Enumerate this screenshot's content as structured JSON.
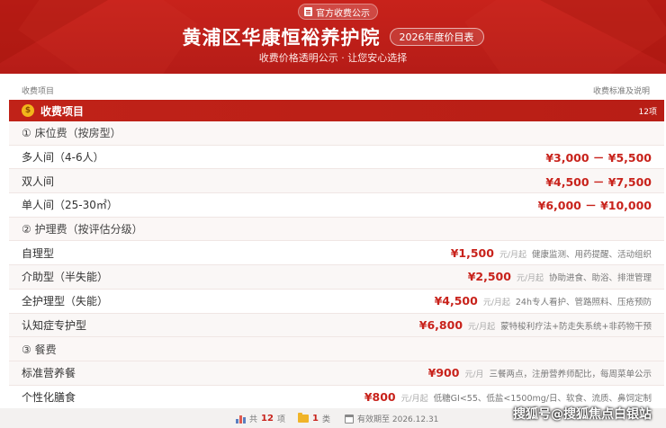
{
  "header": {
    "badge_label": "官方收费公示",
    "title": "黄浦区华康恒裕养护院",
    "year_badge": "2026年度价目表",
    "subtitle": "收费价格透明公示 · 让您安心选择"
  },
  "columns": {
    "left": "收费项目",
    "right": "收费标准及说明"
  },
  "section": {
    "icon": "money-bag-icon",
    "title": "收费项目",
    "count": "12项"
  },
  "rows": [
    {
      "type": "group",
      "name": "① 床位费（按房型）"
    },
    {
      "type": "item",
      "name": "多人间（4-6人）",
      "price": "¥3,000 － ¥5,500",
      "unit": "",
      "note": ""
    },
    {
      "type": "item",
      "name": "双人间",
      "price": "¥4,500 － ¥7,500",
      "unit": "",
      "note": ""
    },
    {
      "type": "item",
      "name": "单人间（25-30㎡）",
      "price": "¥6,000 － ¥10,000",
      "unit": "",
      "note": ""
    },
    {
      "type": "group",
      "name": "② 护理费（按评估分级）"
    },
    {
      "type": "item",
      "name": "自理型",
      "price": "¥1,500",
      "unit": "元/月起",
      "note": "健康监测、用药提醒、活动组织"
    },
    {
      "type": "item",
      "name": "介助型（半失能）",
      "price": "¥2,500",
      "unit": "元/月起",
      "note": "协助进食、助浴、排泄管理"
    },
    {
      "type": "item",
      "name": "全护理型（失能）",
      "price": "¥4,500",
      "unit": "元/月起",
      "note": "24h专人看护、管路照料、压疮预防"
    },
    {
      "type": "item",
      "name": "认知症专护型",
      "price": "¥6,800",
      "unit": "元/月起",
      "note": "蒙特梭利疗法+防走失系统+非药物干预"
    },
    {
      "type": "group",
      "name": "③ 餐费"
    },
    {
      "type": "item",
      "name": "标准营养餐",
      "price": "¥900",
      "unit": "元/月",
      "note": "三餐两点，注册营养师配比，每周菜单公示"
    },
    {
      "type": "item",
      "name": "个性化膳食",
      "price": "¥800",
      "unit": "元/月起",
      "note": "低糖GI<55、低盐<1500mg/日、软食、流质、鼻饲定制"
    }
  ],
  "footer": {
    "total_prefix": "共",
    "total_count": "12",
    "total_suffix": "项",
    "category_count": "1",
    "category_suffix": "类",
    "valid_until": "有效期至 2026.12.31"
  },
  "watermark": "搜狐号@搜狐焦点白银站",
  "colors": {
    "brand_red": "#c8221b",
    "accent_gold": "#f2b51b"
  }
}
